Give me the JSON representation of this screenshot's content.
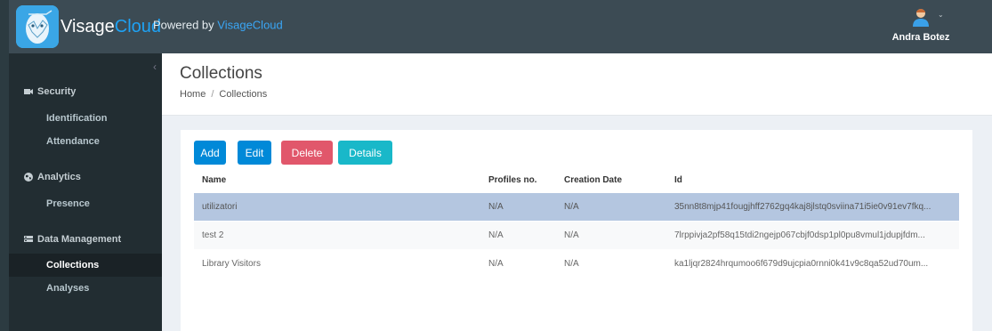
{
  "header": {
    "logo_text_a": "Visage",
    "logo_text_b": "Cloud",
    "powered_prefix": "Powered by",
    "powered_brand": "VisageCloud",
    "user_name": "Andra Botez"
  },
  "sidebar": {
    "collapse_glyph": "‹",
    "sections": [
      {
        "label": "Security",
        "icon": "camera-icon"
      },
      {
        "label": "Analytics",
        "icon": "globe-icon"
      },
      {
        "label": "Data Management",
        "icon": "database-icon"
      }
    ],
    "items": [
      {
        "label": "Identification"
      },
      {
        "label": "Attendance"
      },
      {
        "label": "Presence"
      },
      {
        "label": "Collections",
        "active": true
      },
      {
        "label": "Analyses"
      }
    ]
  },
  "page": {
    "title": "Collections",
    "breadcrumb": [
      "Home",
      "Collections"
    ]
  },
  "toolbar": {
    "add": "Add",
    "edit": "Edit",
    "delete": "Delete",
    "details": "Details"
  },
  "table": {
    "columns": [
      "Name",
      "Profiles no.",
      "Creation Date",
      "Id"
    ],
    "rows": [
      {
        "name": "utilizatori",
        "profiles": "N/A",
        "created": "N/A",
        "id": "35nn8t8mjp41fougjhff2762gq4kaj8jlstq0sviina71i5ie0v91ev7fkq...",
        "selected": true
      },
      {
        "name": "test 2",
        "profiles": "N/A",
        "created": "N/A",
        "id": "7lrppivja2pf58q15tdi2ngejp067cbjf0dsp1pl0pu8vmul1jdupjfdm..."
      },
      {
        "name": "Library Visitors",
        "profiles": "N/A",
        "created": "N/A",
        "id": "ka1ljqr2824hrqumoo6f679d9ujcpia0rnni0k41v9c8qa52ud70um..."
      }
    ]
  },
  "colors": {
    "topbar": "#3c4b54",
    "sidebar": "#222d32",
    "primary": "#0089d8",
    "danger": "#e1576b",
    "info": "#19b8c9",
    "selected_row": "#b4c6e0"
  }
}
